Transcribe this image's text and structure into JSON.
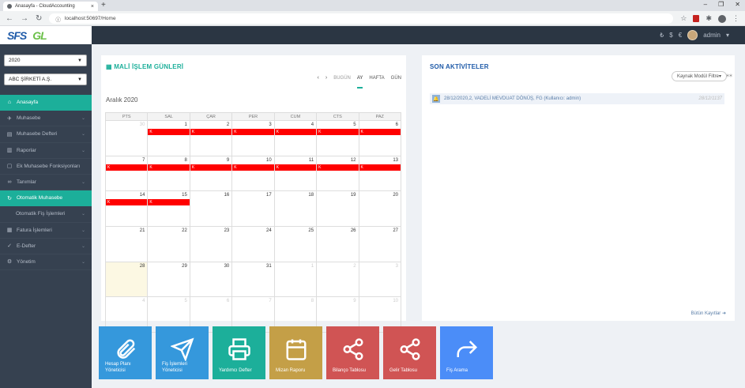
{
  "browser": {
    "tab_title": "Anasayfa - CloudAccounting",
    "url": "localhost:50697/Home"
  },
  "header": {
    "logo_left": "SFS",
    "logo_right": "GL",
    "currencies": [
      "₺",
      "$",
      "€"
    ],
    "user": "admin"
  },
  "sidebar": {
    "year": "2020",
    "company": "ABC ŞİRKETİ A.Ş.",
    "items": [
      {
        "label": "Anasayfa",
        "icon": "home-icon",
        "active": true,
        "chevron": false
      },
      {
        "label": "Muhasebe",
        "icon": "paper-plane-icon",
        "active": false,
        "chevron": true
      },
      {
        "label": "Muhasebe Defteri",
        "icon": "book-icon",
        "active": false,
        "chevron": true
      },
      {
        "label": "Raporlar",
        "icon": "bar-chart-icon",
        "active": false,
        "chevron": true
      },
      {
        "label": "Ek Muhasebe Fonksiyonları",
        "icon": "document-icon",
        "active": false,
        "chevron": false
      },
      {
        "label": "Tanımlar",
        "icon": "link-icon",
        "active": false,
        "chevron": true
      },
      {
        "label": "Otomatik Muhasebe",
        "icon": "refresh-icon",
        "active": true,
        "chevron": false
      },
      {
        "label": "Otomatik Fiş İşlemleri",
        "icon": "",
        "active": false,
        "chevron": true,
        "sub": true
      },
      {
        "label": "Fatura İşlemleri",
        "icon": "invoice-icon",
        "active": false,
        "chevron": true
      },
      {
        "label": "E-Defter",
        "icon": "check-icon",
        "active": false,
        "chevron": true
      },
      {
        "label": "Yönetim",
        "icon": "gear-icon",
        "active": false,
        "chevron": true
      }
    ]
  },
  "calendar": {
    "title": "MALİ İŞLEM GÜNLERİ",
    "today_btn": "BUGÜN",
    "views": [
      "AY",
      "HAFTA",
      "GÜN"
    ],
    "active_view": "AY",
    "month_label": "Aralık 2020",
    "weekdays": [
      "PTS",
      "SAL",
      "ÇAR",
      "PER",
      "CUM",
      "CTS",
      "PAZ"
    ],
    "weeks": [
      [
        {
          "d": "30",
          "o": true
        },
        {
          "d": "1",
          "ev": "K"
        },
        {
          "d": "2",
          "ev": "K"
        },
        {
          "d": "3",
          "ev": "K"
        },
        {
          "d": "4",
          "ev": "K"
        },
        {
          "d": "5",
          "ev": "K"
        },
        {
          "d": "6",
          "ev": "K"
        }
      ],
      [
        {
          "d": "7",
          "ev": "K"
        },
        {
          "d": "8",
          "ev": "K"
        },
        {
          "d": "9",
          "ev": "K"
        },
        {
          "d": "10",
          "ev": "K"
        },
        {
          "d": "11",
          "ev": "K"
        },
        {
          "d": "12",
          "ev": "K"
        },
        {
          "d": "13",
          "ev": "K"
        }
      ],
      [
        {
          "d": "14",
          "ev": "K"
        },
        {
          "d": "15",
          "ev": "K"
        },
        {
          "d": "16"
        },
        {
          "d": "17"
        },
        {
          "d": "18"
        },
        {
          "d": "19"
        },
        {
          "d": "20"
        }
      ],
      [
        {
          "d": "21"
        },
        {
          "d": "22"
        },
        {
          "d": "23"
        },
        {
          "d": "24"
        },
        {
          "d": "25"
        },
        {
          "d": "26"
        },
        {
          "d": "27"
        }
      ],
      [
        {
          "d": "28",
          "today": true
        },
        {
          "d": "29"
        },
        {
          "d": "30"
        },
        {
          "d": "31"
        },
        {
          "d": "1",
          "o": true
        },
        {
          "d": "2",
          "o": true
        },
        {
          "d": "3",
          "o": true
        }
      ],
      [
        {
          "d": "4",
          "o": true
        },
        {
          "d": "5",
          "o": true
        },
        {
          "d": "6",
          "o": true
        },
        {
          "d": "7",
          "o": true
        },
        {
          "d": "8",
          "o": true
        },
        {
          "d": "9",
          "o": true
        },
        {
          "d": "10",
          "o": true
        }
      ]
    ]
  },
  "activities": {
    "title": "SON AKTİVİTELER",
    "filter": "Kaynak Modül Filtre",
    "items": [
      {
        "text": "28/12/2020,2, VADELİ MEVDUAT DÖNÜŞ, FG (Kullanıcı: admin)",
        "date": "28/12/1137"
      }
    ],
    "all_records": "Bütün Kayıtlar"
  },
  "tiles": [
    {
      "label": "Hesap Planı Yöneticisi",
      "color": "#3598dc",
      "icon": "paperclip-icon"
    },
    {
      "label": "Fiş İşlemleri Yöneticisi",
      "color": "#3598dc",
      "icon": "send-icon"
    },
    {
      "label": "Yardımcı Defter",
      "color": "#1caf9a",
      "icon": "printer-icon"
    },
    {
      "label": "Mizan Raporu",
      "color": "#c49f47",
      "icon": "calendar-icon"
    },
    {
      "label": "Bilanço Tablosu",
      "color": "#d05454",
      "icon": "share-icon"
    },
    {
      "label": "Gelir Tablosu",
      "color": "#d05454",
      "icon": "share-icon"
    },
    {
      "label": "Fiş Arama",
      "color": "#4b8df8",
      "icon": "forward-icon"
    }
  ]
}
